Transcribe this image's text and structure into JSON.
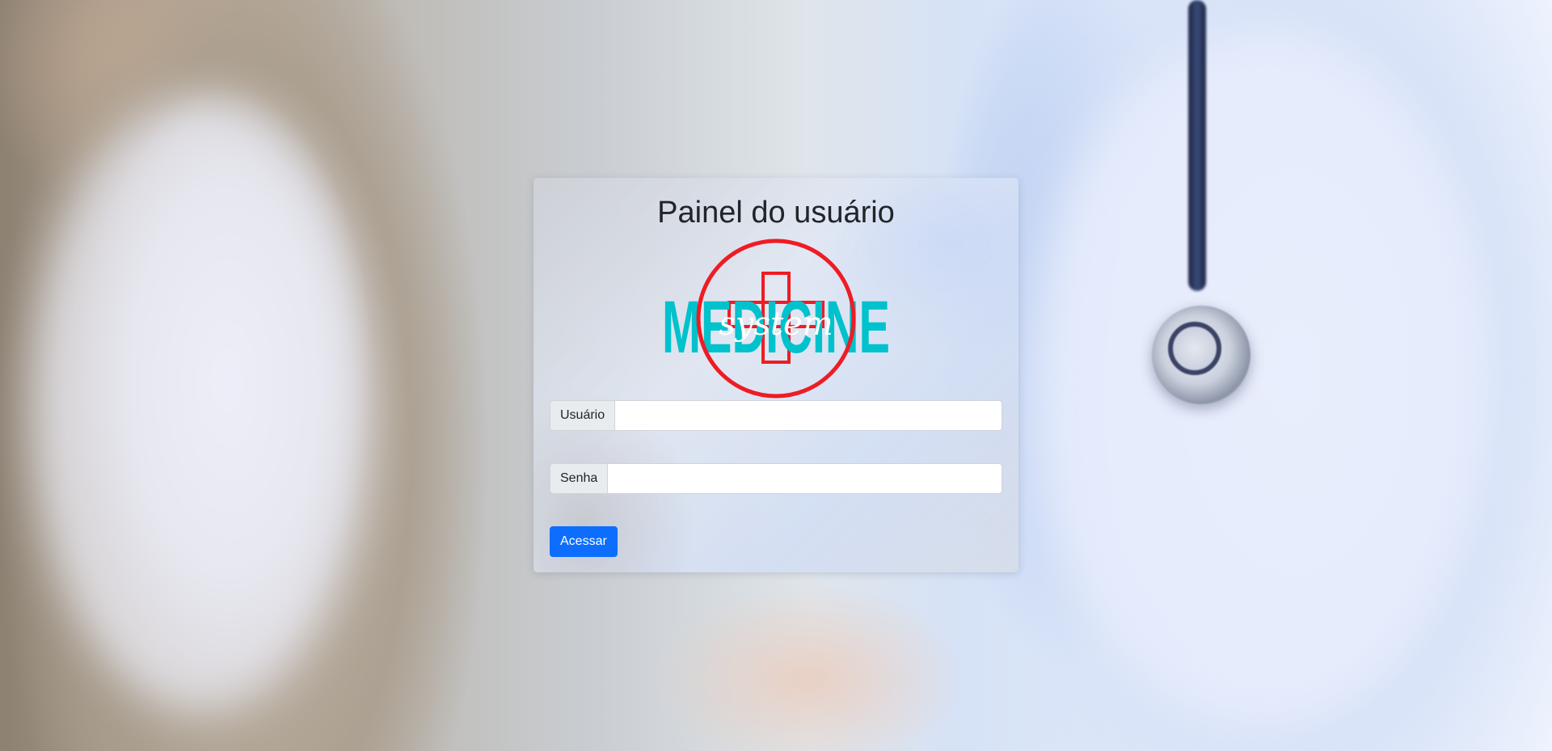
{
  "login": {
    "title": "Painel do usuário",
    "username_label": "Usuário",
    "username_value": "",
    "password_label": "Senha",
    "password_value": "",
    "submit_label": "Acessar"
  },
  "logo": {
    "word": "MEDICINE",
    "script_word": "system",
    "colors": {
      "word": "#00c2cc",
      "cross": "#ee1c24",
      "ring": "#ee1c24",
      "script": "#ffffff"
    }
  },
  "colors": {
    "primary_button": "#0d6efd",
    "title_text": "#212529"
  }
}
